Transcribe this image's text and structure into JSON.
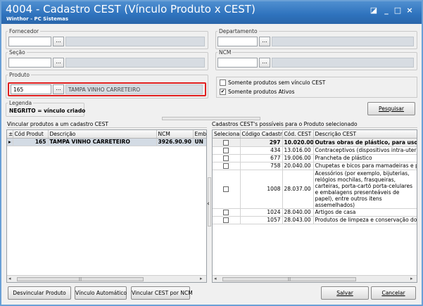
{
  "window": {
    "title": "4004 - Cadastro CEST (Vínculo Produto x CEST)",
    "subtitle": "Winthor - PC Sistemas",
    "controls": [
      "◪",
      "_",
      "□",
      "×"
    ]
  },
  "filters": {
    "fornecedor": {
      "label": "Fornecedor",
      "value": "",
      "desc": ""
    },
    "departamento": {
      "label": "Departamento",
      "value": "",
      "desc": ""
    },
    "secao": {
      "label": "Seção",
      "value": "",
      "desc": ""
    },
    "ncm": {
      "label": "NCM",
      "value": "",
      "desc": ""
    },
    "produto": {
      "label": "Produto",
      "value": "165",
      "desc": "TAMPA VINHO CARRETEIRO"
    },
    "lookup_label": "..."
  },
  "options": {
    "sem_vinculo": {
      "label": "Somente produtos sem vínculo CEST",
      "checked": false
    },
    "ativos": {
      "label": "Somente produtos Ativos",
      "checked": true
    }
  },
  "legenda": {
    "label": "Legenda",
    "text": "NEGRITO = vínculo criado"
  },
  "pesquisar_label": "Pesquisar",
  "left_panel": {
    "title": "Vincular produtos a um cadastro CEST",
    "columns": [
      "Cód Produt",
      "Descrição",
      "NCM",
      "Embal"
    ],
    "rows": [
      {
        "cod": "165",
        "desc": "TAMPA VINHO CARRETEIRO",
        "ncm": "3926.90.90",
        "emb": "UN"
      }
    ]
  },
  "right_panel": {
    "title": "Cadastros CEST's possíveis para o Produto selecionado",
    "columns": [
      "Selecionar",
      "Código Cadastro",
      "Cód. CEST",
      "Descrição CEST"
    ],
    "rows": [
      {
        "cod": "297",
        "cest": "10.020.00",
        "desc": "Outras obras de plástico, para uso na",
        "bold": true
      },
      {
        "cod": "434",
        "cest": "13.016.00",
        "desc": "Contraceptivos (dispositivos intra-uterinos -",
        "bold": false
      },
      {
        "cod": "677",
        "cest": "19.006.00",
        "desc": "Prancheta de plástico",
        "bold": false
      },
      {
        "cod": "758",
        "cest": "20.040.00",
        "desc": "Chupetas e bicos para mamadeiras e para d",
        "bold": false
      },
      {
        "cod": "1008",
        "cest": "28.037.00",
        "desc": "Acessórios (por exemplo, bijuterias, relógios mochilas, frasqueiras, carteiras, porta-cartõ porta-celulares e embalagens presenteáveis de papel), entre outros itens assemelhados)",
        "bold": false
      },
      {
        "cod": "1024",
        "cest": "28.040.00",
        "desc": "Artigos de casa",
        "bold": false
      },
      {
        "cod": "1057",
        "cest": "28.043.00",
        "desc": "Produtos de limpeza e conservação domésti",
        "bold": false
      }
    ]
  },
  "buttons": {
    "desvincular": "Desvincular Produto",
    "automatico": "Vínculo Automático",
    "ncm": "Vincular CEST por NCM",
    "salvar": "Salvar",
    "cancelar": "Cancelar"
  },
  "splitter_arrow": "‹"
}
